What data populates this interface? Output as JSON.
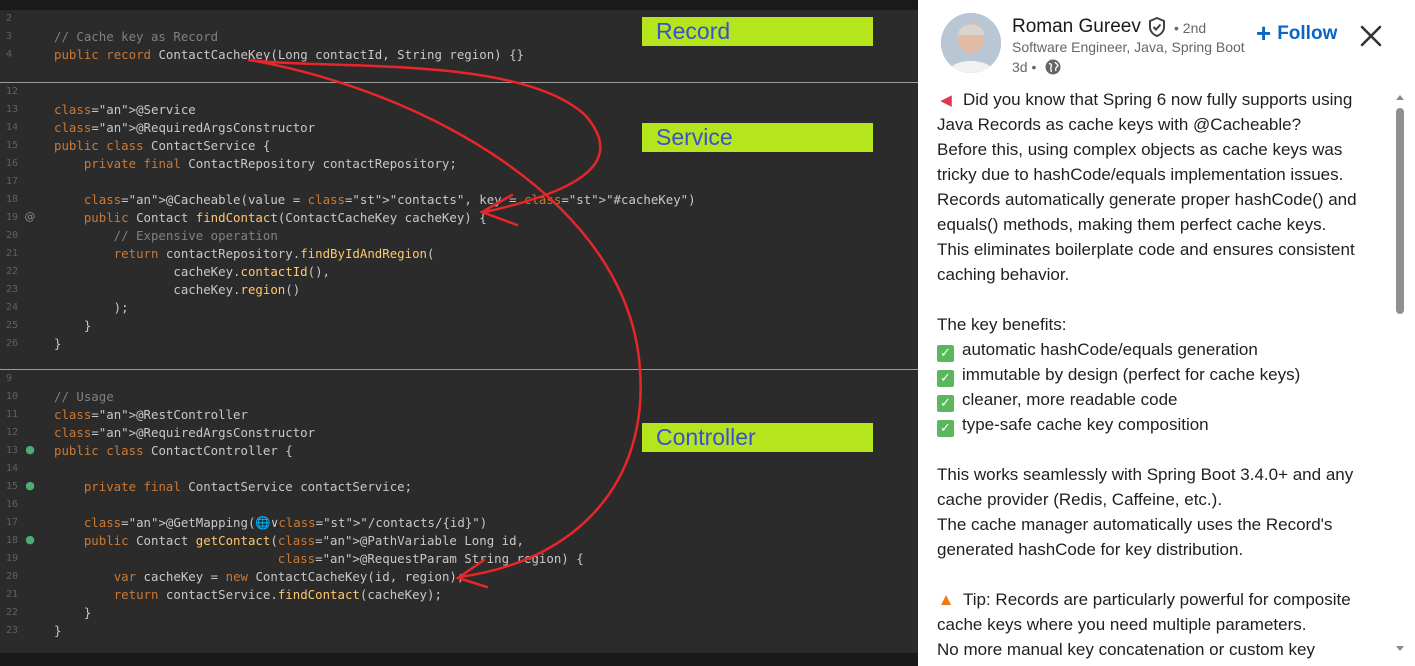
{
  "code_image": {
    "labels": {
      "record": "Record",
      "service": "Service",
      "controller": "Controller"
    },
    "colors": {
      "label_bg": "#b5e61d",
      "label_text": "#3c4fd0",
      "arrow": "#e8262a"
    },
    "record_lines": [
      {
        "num": "2",
        "text": ""
      },
      {
        "num": "3",
        "text": "// Cache key as Record"
      },
      {
        "num": "4",
        "text": "public record ContactCacheKey(Long contactId, String region) {}"
      }
    ],
    "service_lines": [
      {
        "num": "12",
        "text": ""
      },
      {
        "num": "13",
        "text": "@Service"
      },
      {
        "num": "14",
        "text": "@RequiredArgsConstructor"
      },
      {
        "num": "15",
        "text": "public class ContactService {"
      },
      {
        "num": "16",
        "text": "    private final ContactRepository contactRepository;"
      },
      {
        "num": "17",
        "text": ""
      },
      {
        "num": "18",
        "text": "    @Cacheable(value = \"contacts\", key = \"#cacheKey\")"
      },
      {
        "num": "19",
        "text": "    public Contact findContact(ContactCacheKey cacheKey) {"
      },
      {
        "num": "20",
        "text": "        // Expensive operation"
      },
      {
        "num": "21",
        "text": "        return contactRepository.findByIdAndRegion("
      },
      {
        "num": "22",
        "text": "                cacheKey.contactId(),"
      },
      {
        "num": "23",
        "text": "                cacheKey.region()"
      },
      {
        "num": "24",
        "text": "        );"
      },
      {
        "num": "25",
        "text": "    }"
      },
      {
        "num": "26",
        "text": "}"
      }
    ],
    "controller_lines": [
      {
        "num": "9",
        "text": ""
      },
      {
        "num": "10",
        "text": "// Usage"
      },
      {
        "num": "11",
        "text": "@RestController"
      },
      {
        "num": "12",
        "text": "@RequiredArgsConstructor"
      },
      {
        "num": "13",
        "text": "public class ContactController {"
      },
      {
        "num": "14",
        "text": ""
      },
      {
        "num": "15",
        "text": "    private final ContactService contactService;"
      },
      {
        "num": "16",
        "text": ""
      },
      {
        "num": "17",
        "text": "    @GetMapping(🌐∨\"/contacts/{id}\")"
      },
      {
        "num": "18",
        "text": "    public Contact getContact(@PathVariable Long id,"
      },
      {
        "num": "19",
        "text": "                              @RequestParam String region) {"
      },
      {
        "num": "20",
        "text": "        var cacheKey = new ContactCacheKey(id, region);"
      },
      {
        "num": "21",
        "text": "        return contactService.findContact(cacheKey);"
      },
      {
        "num": "22",
        "text": "    }"
      },
      {
        "num": "23",
        "text": "}"
      }
    ]
  },
  "post": {
    "author": {
      "name": "Roman Gureev",
      "degree": "• 2nd",
      "headline": "Software Engineer, Java, Spring Boot",
      "time": "3d •"
    },
    "follow_label": "Follow",
    "lines": [
      {
        "emoji": "megaphone",
        "text": "Did you know that Spring 6 now fully supports using"
      },
      {
        "text": "Java Records as cache keys with @Cacheable?"
      },
      {
        "text": "Before this, using complex objects as cache keys was"
      },
      {
        "text": "tricky due to hashCode/equals implementation issues."
      },
      {
        "text": "Records automatically generate proper hashCode() and"
      },
      {
        "text": "equals() methods, making them perfect cache keys."
      },
      {
        "text": "This eliminates boilerplate code and ensures consistent"
      },
      {
        "text": "caching behavior."
      },
      {
        "text": ""
      },
      {
        "text": "The key benefits:"
      },
      {
        "emoji": "check",
        "text": "automatic hashCode/equals generation"
      },
      {
        "emoji": "check",
        "text": "immutable by design (perfect for cache keys)"
      },
      {
        "emoji": "check",
        "text": "cleaner, more readable code"
      },
      {
        "emoji": "check",
        "text": "type-safe cache key composition"
      },
      {
        "text": ""
      },
      {
        "text": "This works seamlessly with Spring Boot 3.4.0+ and any"
      },
      {
        "text": "cache provider (Redis, Caffeine, etc.)."
      },
      {
        "text": "The cache manager automatically uses the Record's"
      },
      {
        "text": "generated hashCode for key distribution."
      },
      {
        "text": ""
      },
      {
        "emoji": "fire",
        "text": "Tip: Records are particularly powerful for composite"
      },
      {
        "text": "cache keys where you need multiple parameters."
      },
      {
        "text": "No more manual key concatenation or custom key"
      }
    ]
  }
}
